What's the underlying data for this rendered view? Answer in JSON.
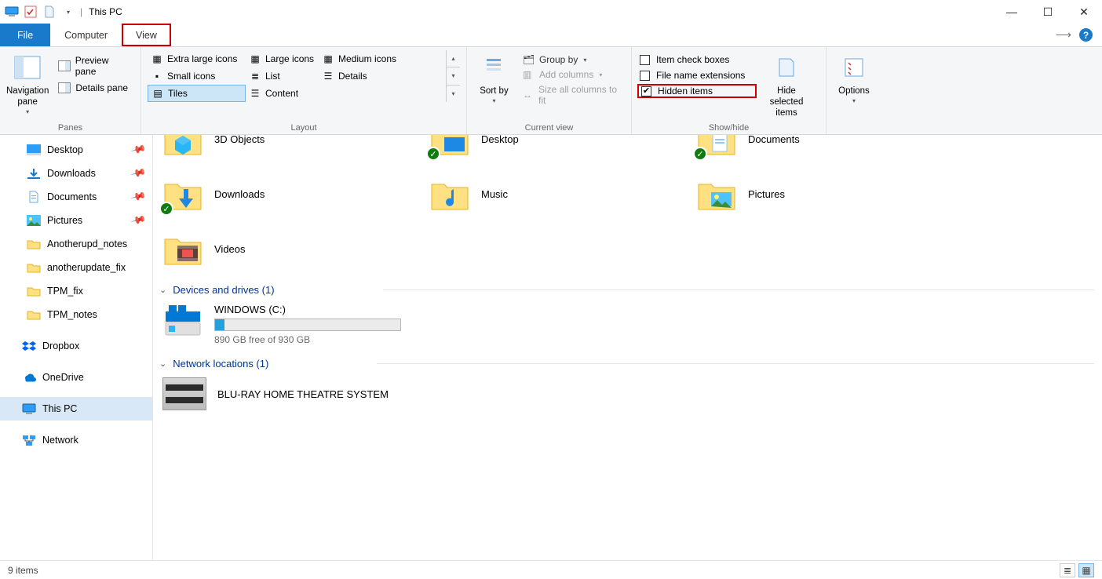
{
  "titlebar": {
    "title": "This PC"
  },
  "tabs": {
    "file": "File",
    "computer": "Computer",
    "view": "View"
  },
  "ribbon": {
    "panes": {
      "navigation": "Navigation pane",
      "preview": "Preview pane",
      "details": "Details pane",
      "group_label": "Panes"
    },
    "layout": {
      "items": {
        "xl": "Extra large icons",
        "lg": "Large icons",
        "md": "Medium icons",
        "sm": "Small icons",
        "list": "List",
        "details": "Details",
        "tiles": "Tiles",
        "content": "Content"
      },
      "group_label": "Layout"
    },
    "current_view": {
      "sort_by": "Sort by",
      "group_by": "Group by",
      "add_columns": "Add columns",
      "size_all": "Size all columns to fit",
      "group_label": "Current view"
    },
    "show_hide": {
      "item_check": "Item check boxes",
      "file_ext": "File name extensions",
      "hidden": "Hidden items",
      "hide_selected": "Hide selected items",
      "group_label": "Show/hide"
    },
    "options": "Options"
  },
  "nav": {
    "items": [
      {
        "label": "Desktop",
        "pinned": true
      },
      {
        "label": "Downloads",
        "pinned": true
      },
      {
        "label": "Documents",
        "pinned": true
      },
      {
        "label": "Pictures",
        "pinned": true
      },
      {
        "label": "Anotherupd_notes"
      },
      {
        "label": "anotherupdate_fix"
      },
      {
        "label": "TPM_fix"
      },
      {
        "label": "TPM_notes"
      }
    ],
    "dropbox": "Dropbox",
    "onedrive": "OneDrive",
    "thispc": "This PC",
    "network": "Network"
  },
  "main": {
    "folders_row1": [
      {
        "name": "3D Objects"
      },
      {
        "name": "Desktop"
      },
      {
        "name": "Documents"
      }
    ],
    "folders_row2": [
      {
        "name": "Downloads"
      },
      {
        "name": "Music"
      },
      {
        "name": "Pictures"
      }
    ],
    "folders_row3": [
      {
        "name": "Videos"
      }
    ],
    "devices_header": "Devices and drives (1)",
    "drive": {
      "name": "WINDOWS (C:)",
      "sub": "890 GB free of 930 GB"
    },
    "netloc_header": "Network locations (1)",
    "netdev": "BLU-RAY HOME THEATRE SYSTEM"
  },
  "status": {
    "count": "9 items"
  }
}
